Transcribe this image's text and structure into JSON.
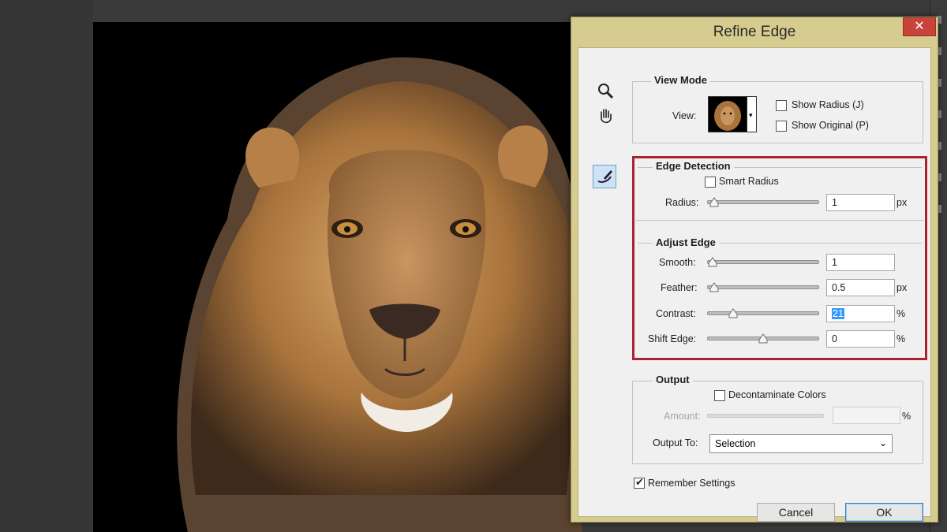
{
  "dialog": {
    "title": "Refine Edge",
    "close_glyph": "✕",
    "tools": [
      "zoom-icon",
      "hand-icon",
      "refine-radius-brush-icon"
    ]
  },
  "view_mode": {
    "legend": "View Mode",
    "view_label": "View:",
    "dropdown_glyph": "▾",
    "show_radius": {
      "label": "Show Radius (J)",
      "checked": false
    },
    "show_original": {
      "label": "Show Original (P)",
      "checked": false
    }
  },
  "edge_detection": {
    "legend": "Edge Detection",
    "smart_radius": {
      "label": "Smart Radius",
      "checked": false
    },
    "radius": {
      "label": "Radius:",
      "value": "1",
      "unit": "px",
      "level": 0.02
    }
  },
  "adjust_edge": {
    "legend": "Adjust Edge",
    "smooth": {
      "label": "Smooth:",
      "value": "1",
      "unit": "",
      "level": 0.01
    },
    "feather": {
      "label": "Feather:",
      "value": "0.5",
      "unit": "px",
      "level": 0.02
    },
    "contrast": {
      "label": "Contrast:",
      "value": "21",
      "unit": "%",
      "level": 0.21
    },
    "shift_edge": {
      "label": "Shift Edge:",
      "value": "0",
      "unit": "%",
      "level": 0.5
    }
  },
  "output": {
    "legend": "Output",
    "decontaminate": {
      "label": "Decontaminate Colors",
      "checked": false
    },
    "amount": {
      "label": "Amount:",
      "value": "",
      "unit": "%"
    },
    "output_to": {
      "label": "Output To:",
      "value": "Selection",
      "arrow": "⌄"
    }
  },
  "remember_settings": {
    "label": "Remember Settings",
    "checked": true
  },
  "buttons": {
    "cancel": "Cancel",
    "ok": "OK"
  },
  "colors": {
    "dialog_frame": "#d7cc8f",
    "highlight": "#a8232f",
    "close": "#c8443b",
    "canvas": "#000000"
  }
}
